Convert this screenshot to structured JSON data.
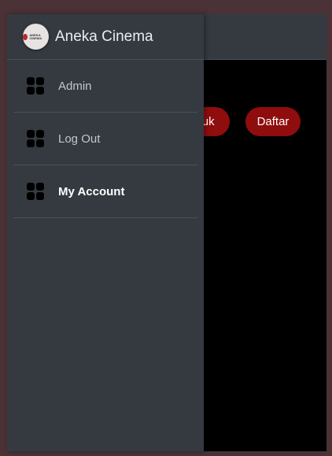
{
  "brand": {
    "title": "Aneka Cinema",
    "logo_text": "ANEKA CINEMA"
  },
  "sidebar": {
    "items": [
      {
        "label": "Admin",
        "icon": "grid-icon",
        "active": false
      },
      {
        "label": "Log Out",
        "icon": "grid-icon",
        "active": false
      },
      {
        "label": "My Account",
        "icon": "grid-icon",
        "active": true
      }
    ]
  },
  "header": {
    "masuk_label": "Masuk",
    "daftar_label": "Daftar"
  },
  "colors": {
    "sidebar_bg": "#343a40",
    "button_red": "#8f0d0d",
    "background": "#4a3236"
  }
}
